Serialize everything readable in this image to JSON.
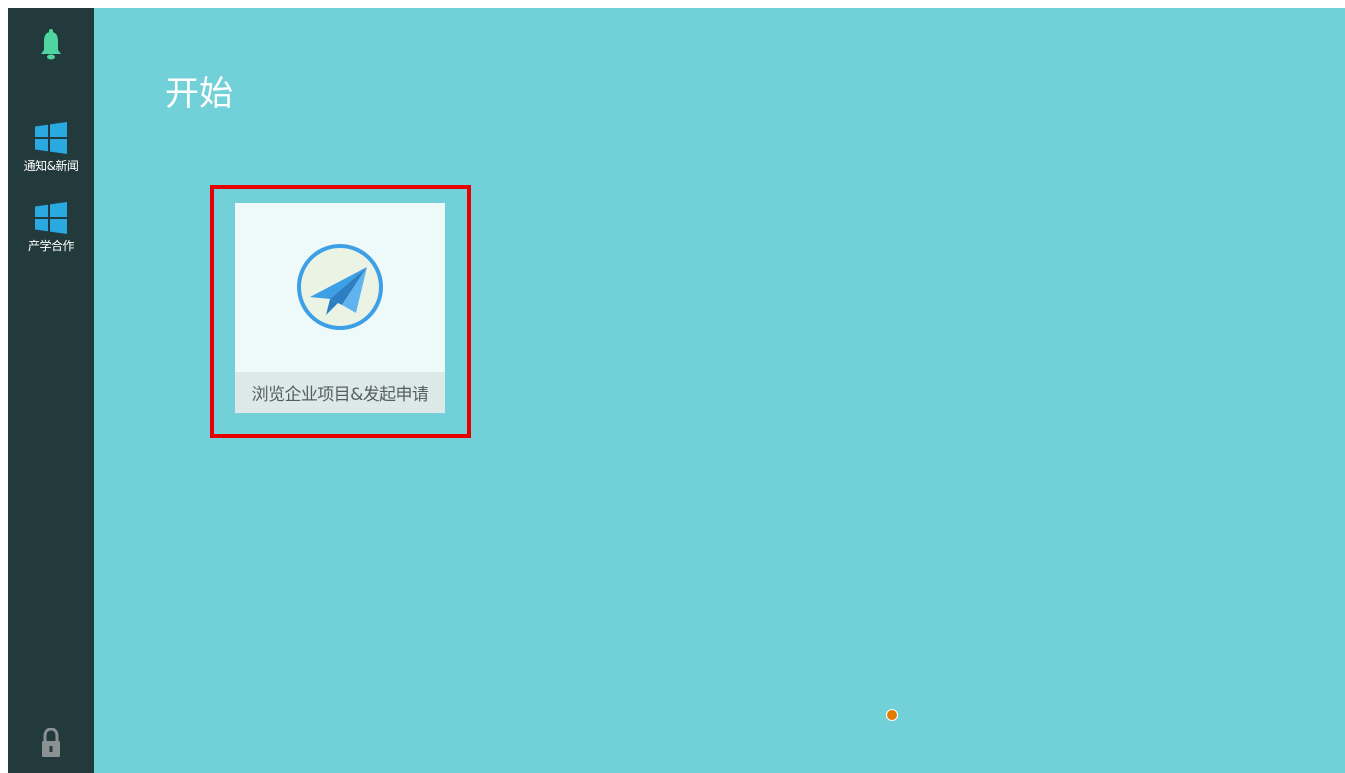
{
  "title": "开始",
  "sidebar": {
    "items": [
      {
        "label": "通知&新闻",
        "icon": "windows-icon"
      },
      {
        "label": "产学合作",
        "icon": "windows-icon"
      }
    ],
    "top_icon": "bell-icon",
    "bottom_icon": "lock-icon"
  },
  "tiles": [
    {
      "label": "浏览企业项目&发起申请",
      "icon": "paper-plane-icon"
    }
  ],
  "colors": {
    "background": "#72d0d8",
    "sidebar": "#233a3d",
    "accent": "#2aa9e0",
    "highlight": "#e60000",
    "bell": "#4fd6a0"
  }
}
